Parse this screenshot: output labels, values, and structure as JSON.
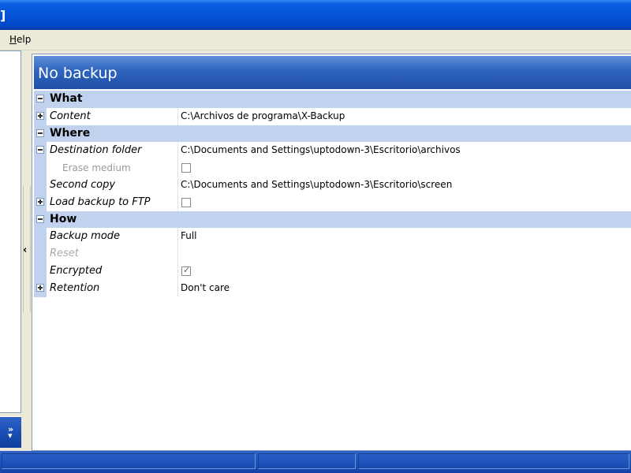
{
  "window": {
    "title": "]"
  },
  "menubar": {
    "items": [
      {
        "label": "Help",
        "mnemonic": "H",
        "rest": "elp"
      }
    ]
  },
  "panel": {
    "title": "No backup"
  },
  "categories": {
    "what": "What",
    "where": "Where",
    "how": "How"
  },
  "properties": {
    "content": {
      "name": "Content",
      "value": "C:\\Archivos de programa\\X-Backup"
    },
    "destination_folder": {
      "name": "Destination folder",
      "value": "C:\\Documents and Settings\\uptodown-3\\Escritorio\\archivos"
    },
    "erase_medium": {
      "name": "Erase medium",
      "checked": false
    },
    "second_copy": {
      "name": "Second copy",
      "value": "C:\\Documents and Settings\\uptodown-3\\Escritorio\\screen"
    },
    "load_backup_ftp": {
      "name": "Load backup to FTP",
      "checked": false
    },
    "backup_mode": {
      "name": "Backup mode",
      "value": "Full"
    },
    "reset": {
      "name": "Reset",
      "value": ""
    },
    "encrypted": {
      "name": "Encrypted",
      "checked": true
    },
    "retention": {
      "name": "Retention",
      "value": "Don't care"
    }
  },
  "icons": {
    "expander_expanded": "minus-box-icon",
    "expander_collapsed": "plus-box-icon",
    "collapse_arrow": "chevron-left-icon",
    "more": "double-chevron-right-icon"
  },
  "colors": {
    "titlebar": "#0553d6",
    "panel_header": "#2f64be",
    "category_band": "#c1d2ee",
    "statusbar": "#1f54bd"
  }
}
